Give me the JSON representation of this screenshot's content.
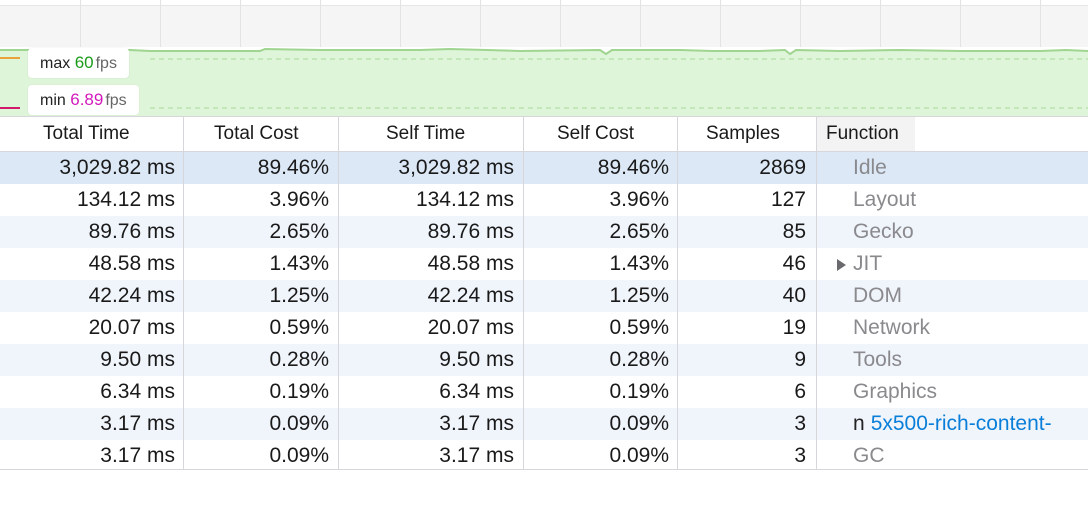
{
  "fps": {
    "max_label": "max",
    "max_value": "60",
    "min_label": "min",
    "min_value": "6.89",
    "unit": "fps"
  },
  "table": {
    "headers": {
      "total_time": "Total Time",
      "total_cost": "Total Cost",
      "self_time": "Self Time",
      "self_cost": "Self Cost",
      "samples": "Samples",
      "function": "Function"
    },
    "rows": [
      {
        "total_time": "3,029.82 ms",
        "total_cost": "89.46%",
        "self_time": "3,029.82 ms",
        "self_cost": "89.46%",
        "samples": "2869",
        "function": "Idle"
      },
      {
        "total_time": "134.12 ms",
        "total_cost": "3.96%",
        "self_time": "134.12 ms",
        "self_cost": "3.96%",
        "samples": "127",
        "function": "Layout"
      },
      {
        "total_time": "89.76 ms",
        "total_cost": "2.65%",
        "self_time": "89.76 ms",
        "self_cost": "2.65%",
        "samples": "85",
        "function": "Gecko"
      },
      {
        "total_time": "48.58 ms",
        "total_cost": "1.43%",
        "self_time": "48.58 ms",
        "self_cost": "1.43%",
        "samples": "46",
        "function": "JIT"
      },
      {
        "total_time": "42.24 ms",
        "total_cost": "1.25%",
        "self_time": "42.24 ms",
        "self_cost": "1.25%",
        "samples": "40",
        "function": "DOM"
      },
      {
        "total_time": "20.07 ms",
        "total_cost": "0.59%",
        "self_time": "20.07 ms",
        "self_cost": "0.59%",
        "samples": "19",
        "function": "Network"
      },
      {
        "total_time": "9.50 ms",
        "total_cost": "0.28%",
        "self_time": "9.50 ms",
        "self_cost": "0.28%",
        "samples": "9",
        "function": "Tools"
      },
      {
        "total_time": "6.34 ms",
        "total_cost": "0.19%",
        "self_time": "6.34 ms",
        "self_cost": "0.19%",
        "samples": "6",
        "function": "Graphics"
      },
      {
        "total_time": "3.17 ms",
        "total_cost": "0.09%",
        "self_time": "3.17 ms",
        "self_cost": "0.09%",
        "samples": "3",
        "function_prefix": "n",
        "function_link": "5x500-rich-content-"
      },
      {
        "total_time": "3.17 ms",
        "total_cost": "0.09%",
        "self_time": "3.17 ms",
        "self_cost": "0.09%",
        "samples": "3",
        "function": "GC"
      }
    ]
  },
  "colors": {
    "graph_fill": "#def5d9",
    "graph_line": "#9fd590",
    "max_accent": "#1b9a1b",
    "min_accent": "#d21abc",
    "selected_row": "#dce8f6",
    "link": "#0a7fd9"
  }
}
